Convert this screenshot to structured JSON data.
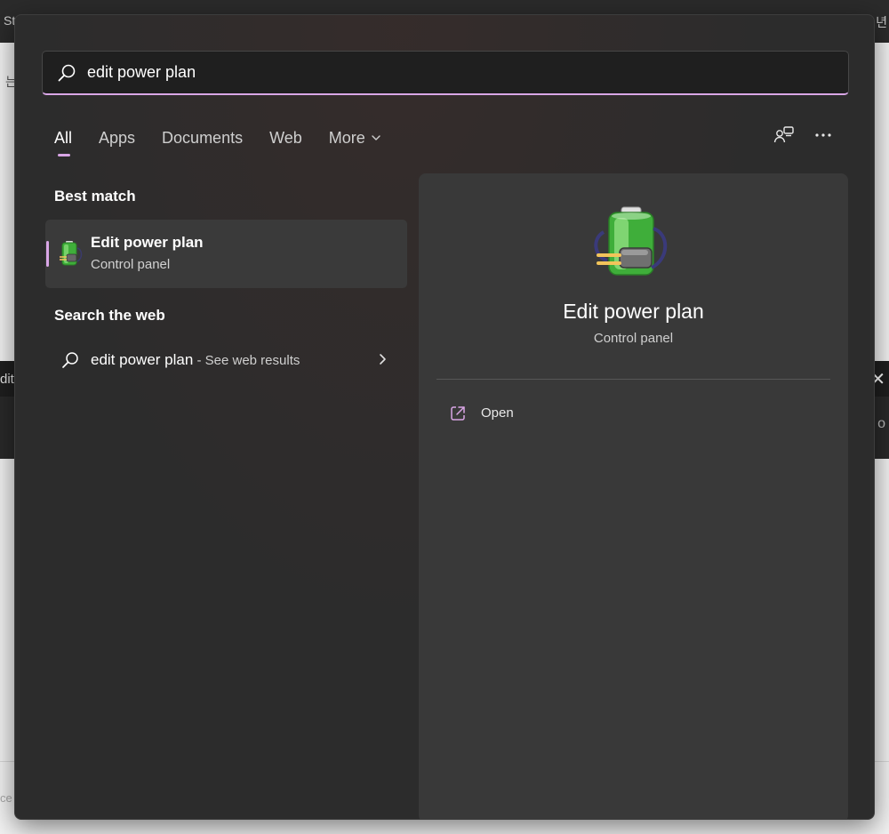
{
  "background": {
    "topbar_left_text": "St",
    "topbar_right_text": "년",
    "left_glyph": "는",
    "band_left_text": "dit",
    "band_close_glyph": "✕",
    "band_right_glyph": "ο",
    "bottom_text": "ce"
  },
  "search": {
    "query": "edit power plan",
    "icon": "search-icon"
  },
  "tabs": [
    {
      "label": "All",
      "active": true
    },
    {
      "label": "Apps",
      "active": false
    },
    {
      "label": "Documents",
      "active": false
    },
    {
      "label": "Web",
      "active": false
    },
    {
      "label": "More",
      "active": false
    }
  ],
  "toolbar": {
    "icons": [
      "account-switch-icon",
      "more-options-icon"
    ]
  },
  "best_match": {
    "heading": "Best match",
    "title": "Edit power plan",
    "subtitle": "Control panel",
    "icon": "battery-plug-icon"
  },
  "web": {
    "heading": "Search the web",
    "query": "edit power plan",
    "suffix": " - See web results"
  },
  "preview": {
    "title": "Edit power plan",
    "subtitle": "Control panel",
    "actions": [
      {
        "label": "Open",
        "icon": "open-external-icon"
      }
    ]
  },
  "colors": {
    "accent": "#d9a6e6",
    "panel": "#2c2c2c",
    "preview": "#393939",
    "card": "#3a3a3a"
  }
}
